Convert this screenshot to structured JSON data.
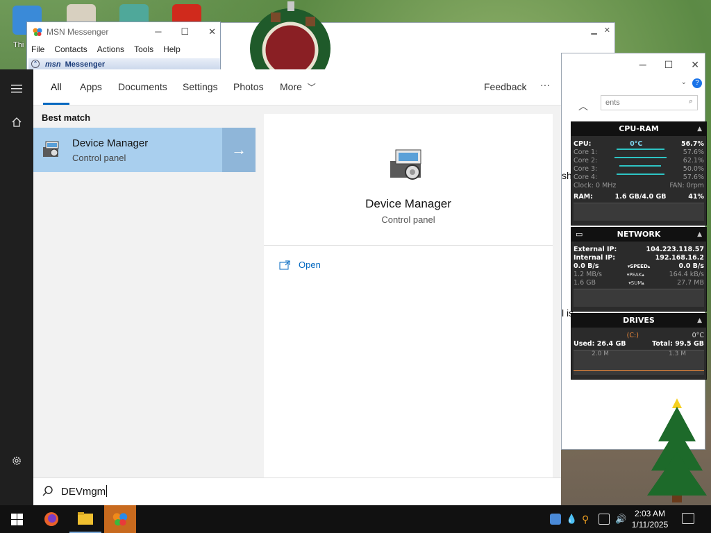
{
  "msn": {
    "title": "MSN Messenger",
    "menu": [
      "File",
      "Contacts",
      "Actions",
      "Tools",
      "Help"
    ],
    "brand_msn": "msn",
    "brand_label": "Messenger"
  },
  "bg_page": {
    "title_fragment": ""
  },
  "desktop": {
    "icon_label": "Thi"
  },
  "right_window": {
    "search_placeholder": "ents",
    "text_fragment_1": "sh",
    "text_fragment_2": "l is"
  },
  "search": {
    "tabs": [
      "All",
      "Apps",
      "Documents",
      "Settings",
      "Photos",
      "More"
    ],
    "active_tab": "All",
    "feedback_label": "Feedback",
    "more_options": "···",
    "best_match_label": "Best match",
    "result": {
      "name": "Device Manager",
      "type": "Control panel"
    },
    "preview": {
      "name": "Device Manager",
      "type": "Control panel",
      "open_label": "Open"
    },
    "query": "DEVmgm"
  },
  "gadget_cpu": {
    "title": "CPU-RAM",
    "cpu_label": "CPU:",
    "cpu_temp": "0°C",
    "cpu_pct": "56.7%",
    "cores": [
      {
        "label": "Core 1:",
        "value": "57.6%",
        "level": 0.576
      },
      {
        "label": "Core 2:",
        "value": "62.1%",
        "level": 0.621
      },
      {
        "label": "Core 3:",
        "value": "50.0%",
        "level": 0.5
      },
      {
        "label": "Core 4:",
        "value": "57.6%",
        "level": 0.576
      }
    ],
    "clock": "Clock: 0 MHz",
    "fan": "FAN: 0rpm",
    "ram_label": "RAM:",
    "ram_value": "1.6 GB/4.0 GB",
    "ram_pct": "41%"
  },
  "gadget_net": {
    "title": "NETWORK",
    "ext_label": "External IP:",
    "ext_ip": "104.223.118.57",
    "int_label": "Internal IP:",
    "int_ip": "192.168.16.2",
    "speed_left": "0.0 B/s",
    "speed_label": "SPEED",
    "speed_right": "0.0 B/s",
    "peak_left": "1.2 MB/s",
    "peak_label": "PEAK",
    "peak_right": "164.4 kB/s",
    "sum_left": "1.6 GB",
    "sum_label": "SUM",
    "sum_right": "27.7 MB"
  },
  "gadget_drives": {
    "title": "DRIVES",
    "drive": "(C:)",
    "temp": "0°C",
    "used": "Used: 26.4 GB",
    "total": "Total: 99.5 GB",
    "read": "2.0 M",
    "write": "1.3 M"
  },
  "taskbar": {
    "time": "2:03 AM",
    "date": "1/11/2025"
  },
  "colors": {
    "accent": "#0067c0",
    "selected": "#a9cfee",
    "taskbar": "#111111",
    "gadget": "#2b2b2b"
  }
}
